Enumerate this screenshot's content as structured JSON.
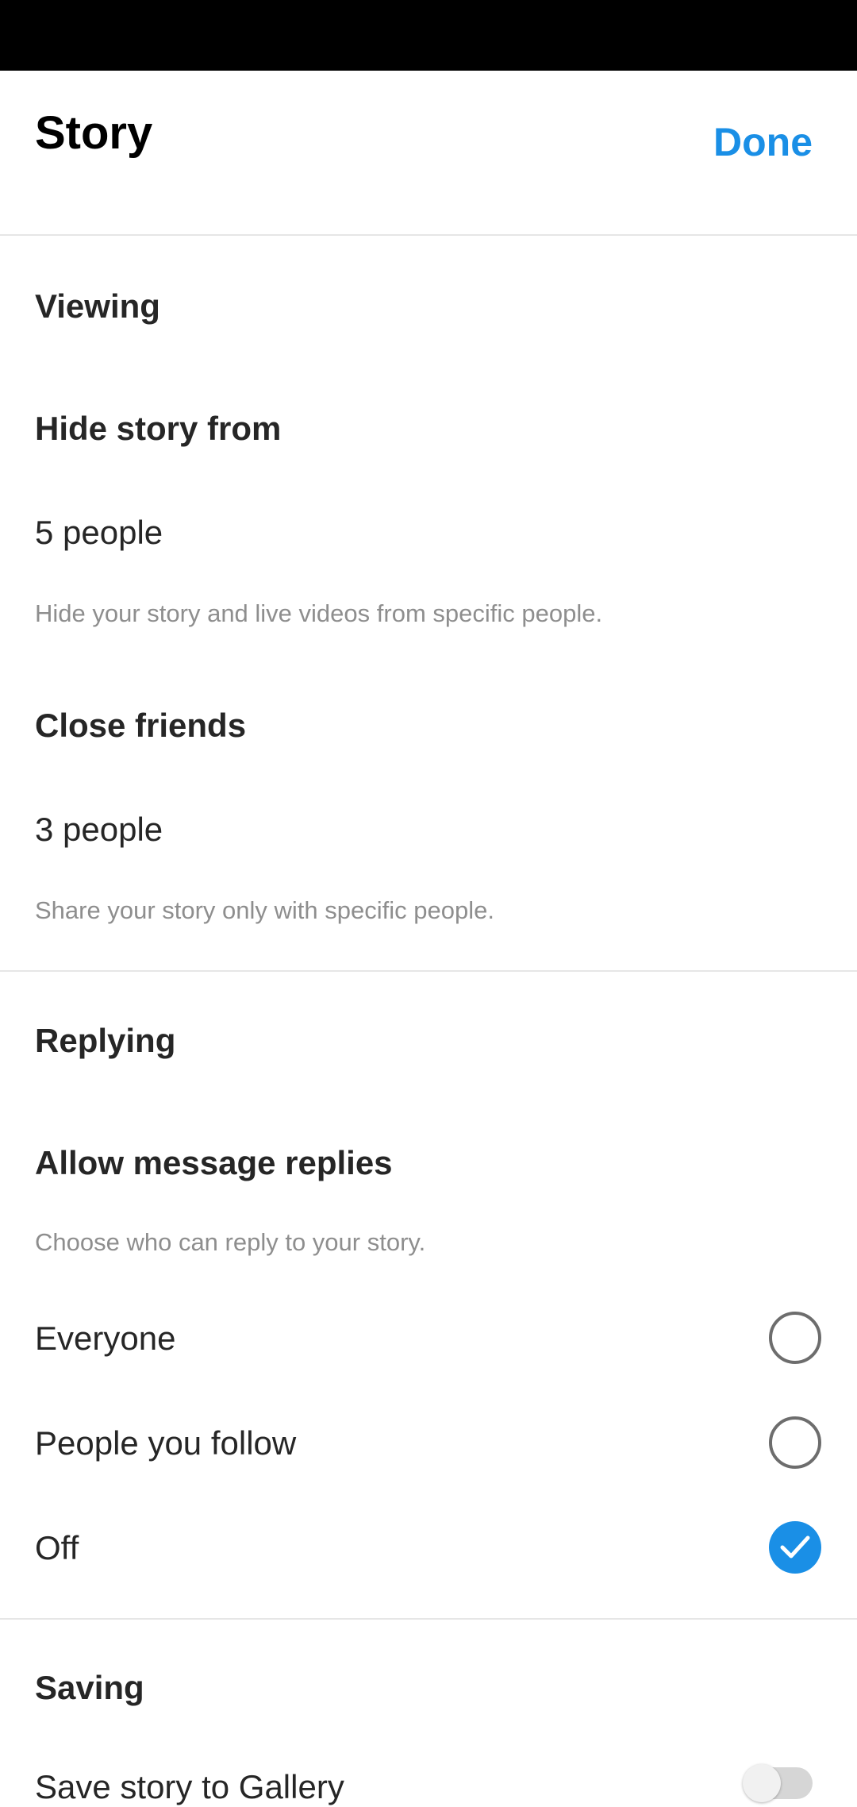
{
  "header": {
    "title": "Story",
    "done_label": "Done"
  },
  "viewing": {
    "section_title": "Viewing",
    "hide_story": {
      "title": "Hide story from",
      "value": "5 people",
      "description": "Hide your story and live videos from specific people."
    },
    "close_friends": {
      "title": "Close friends",
      "value": "3 people",
      "description": "Share your story only with specific people."
    }
  },
  "replying": {
    "section_title": "Replying",
    "allow_replies": {
      "title": "Allow message replies",
      "description": "Choose who can reply to your story."
    },
    "options": [
      {
        "label": "Everyone",
        "selected": false
      },
      {
        "label": "People you follow",
        "selected": false
      },
      {
        "label": "Off",
        "selected": true
      }
    ]
  },
  "saving": {
    "section_title": "Saving",
    "save_to_gallery_label": "Save story to Gallery",
    "save_to_gallery_on": false
  },
  "colors": {
    "accent": "#1a8fe6",
    "text": "#262626",
    "secondary": "#8e8e8e",
    "divider": "#e6e6e6"
  }
}
